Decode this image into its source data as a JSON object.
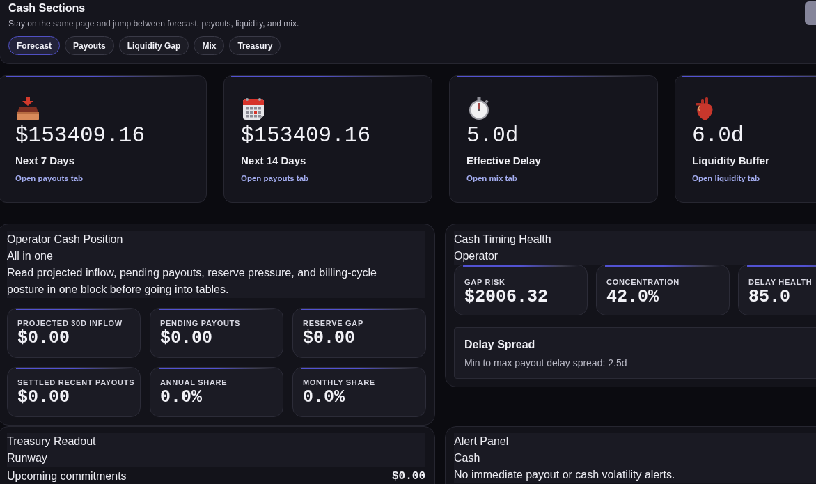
{
  "header": {
    "title": "Cash Sections",
    "description": "Stay on the same page and jump between forecast, payouts, liquidity, and mix.",
    "tabs": [
      {
        "label": "Forecast",
        "selected": true
      },
      {
        "label": "Payouts",
        "selected": false
      },
      {
        "label": "Liquidity Gap",
        "selected": false
      },
      {
        "label": "Mix",
        "selected": false
      },
      {
        "label": "Treasury",
        "selected": false
      }
    ]
  },
  "kpis": [
    {
      "value": "$153409.16",
      "label": "Next 7 Days",
      "link": "Open payouts tab"
    },
    {
      "value": "$153409.16",
      "label": "Next 14 Days",
      "link": "Open payouts tab"
    },
    {
      "value": "5.0d",
      "label": "Effective Delay",
      "link": "Open mix tab"
    },
    {
      "value": "6.0d",
      "label": "Liquidity Buffer",
      "link": "Open liquidity tab"
    }
  ],
  "cash_position": {
    "title": "Operator Cash Position",
    "subtitle": "All in one",
    "description": "Read projected inflow, pending payouts, reserve pressure, and billing-cycle posture in one block before going into tables.",
    "stats": [
      {
        "label": "PROJECTED 30D INFLOW",
        "value": "$0.00"
      },
      {
        "label": "PENDING PAYOUTS",
        "value": "$0.00"
      },
      {
        "label": "RESERVE GAP",
        "value": "$0.00"
      },
      {
        "label": "SETTLED RECENT PAYOUTS",
        "value": "$0.00"
      },
      {
        "label": "ANNUAL SHARE",
        "value": "0.0%"
      },
      {
        "label": "MONTHLY SHARE",
        "value": "0.0%"
      }
    ]
  },
  "cash_timing": {
    "title": "Cash Timing Health",
    "subtitle": "Operator",
    "stats": [
      {
        "label": "GAP RISK",
        "value": "$2006.32"
      },
      {
        "label": "CONCENTRATION",
        "value": "42.0%"
      },
      {
        "label": "DELAY HEALTH",
        "value": "85.0"
      }
    ],
    "delay_spread": {
      "title": "Delay Spread",
      "text": "Min to max payout delay spread: 2.5d"
    }
  },
  "treasury": {
    "title": "Treasury Readout",
    "subtitle": "Runway",
    "rows": [
      {
        "label": "Upcoming commitments",
        "value": "$0.00"
      }
    ]
  },
  "alerts": {
    "title": "Alert Panel",
    "subtitle": "Cash",
    "message": "No immediate payout or cash volatility alerts."
  }
}
